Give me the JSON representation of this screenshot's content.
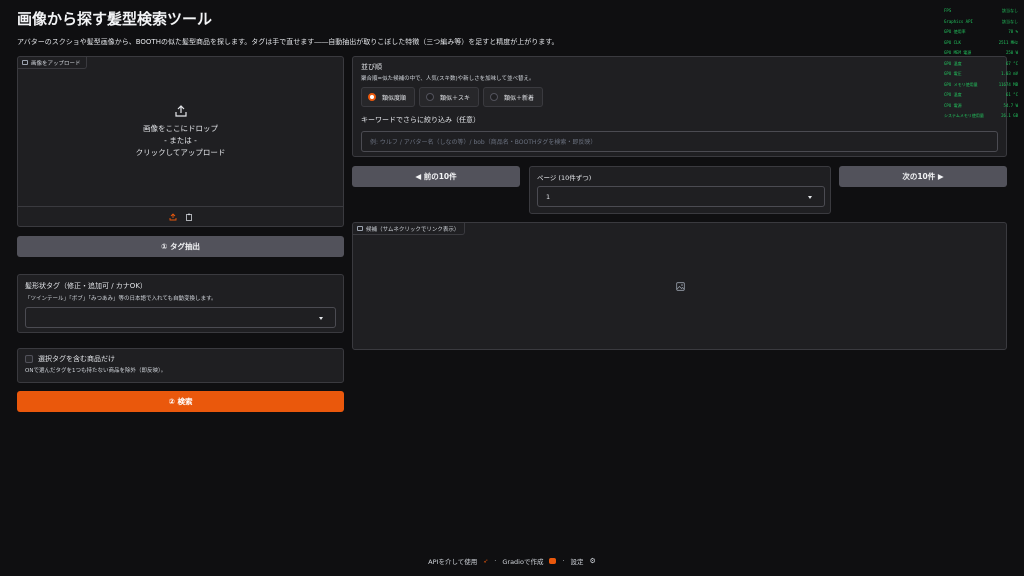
{
  "header": {
    "title": "画像から探す髪型検索ツール",
    "subtitle": "アバターのスクショや髪型画像から、BOOTHの似た髪型商品を探します。タグは手で直せます――自動抽出が取りこぼした特徴（三つ編み等）を足すと精度が上がります。"
  },
  "upload": {
    "label": "画像をアップロード",
    "drop_text": "画像をここにドロップ",
    "or_text": "- または -",
    "click_text": "クリックしてアップロード"
  },
  "buttons": {
    "extract_tags": "① タグ抽出",
    "search": "② 検索",
    "prev": "◀ 前の10件",
    "next": "次の10件 ▶"
  },
  "tag_field": {
    "label": "髪形状タグ（修正・追加可 / カナOK）",
    "info": "「ツインテール」「ボブ」「みつあみ」等の日本語で入れても自動変換します。",
    "value": ""
  },
  "filter_checkbox": {
    "label": "選択タグを含む商品だけ",
    "info": "ONで選んだタグを1つも持たない商品を除外（即反映）。",
    "checked": false
  },
  "sort": {
    "label": "並び順",
    "info": "聚合順=似た候補の中で、人気(スキ数)や新しさを加味して並べ替え。",
    "options": [
      "類似度順",
      "類似＋スキ",
      "類似＋新着"
    ],
    "selected": "類似度順"
  },
  "keyword": {
    "label": "キーワードでさらに絞り込み（任意）",
    "placeholder": "例: ウルフ / アバター名（しなの等）/ bob（商品名・BOOTHタグを検索・即反映）"
  },
  "page": {
    "label": "ページ (10件ずつ)",
    "value": "1"
  },
  "gallery": {
    "label": "候補（サムネクリックでリンク表示）"
  },
  "footer": {
    "api": "APIを介して使用",
    "built": "Gradioで作成",
    "settings": "設定",
    "sep": "·"
  },
  "overlay": [
    {
      "k": "FPS",
      "v": "該当なし"
    },
    {
      "k": "Graphics API",
      "v": "該当なし"
    },
    {
      "k": "GPU 使用率",
      "v": "78 %"
    },
    {
      "k": "GPU CLK",
      "v": "2511 MHz"
    },
    {
      "k": "GPU MEM 電源",
      "v": "250 W"
    },
    {
      "k": "GPU 温度",
      "v": "67 °C"
    },
    {
      "k": "GPU 電圧",
      "v": "1.03 mV"
    },
    {
      "k": "GPU メモリ使用量",
      "v": "11674 MB"
    },
    {
      "k": "CPU 温度",
      "v": "61 °C"
    },
    {
      "k": "CPU 電源",
      "v": "54.7 W"
    },
    {
      "k": "システムメモリ使用量",
      "v": "26.1 GB"
    }
  ],
  "colors": {
    "accent": "#ea580c",
    "background": "#0f0f11",
    "panel": "#1f1f22",
    "overlay_text": "#22c55e"
  }
}
